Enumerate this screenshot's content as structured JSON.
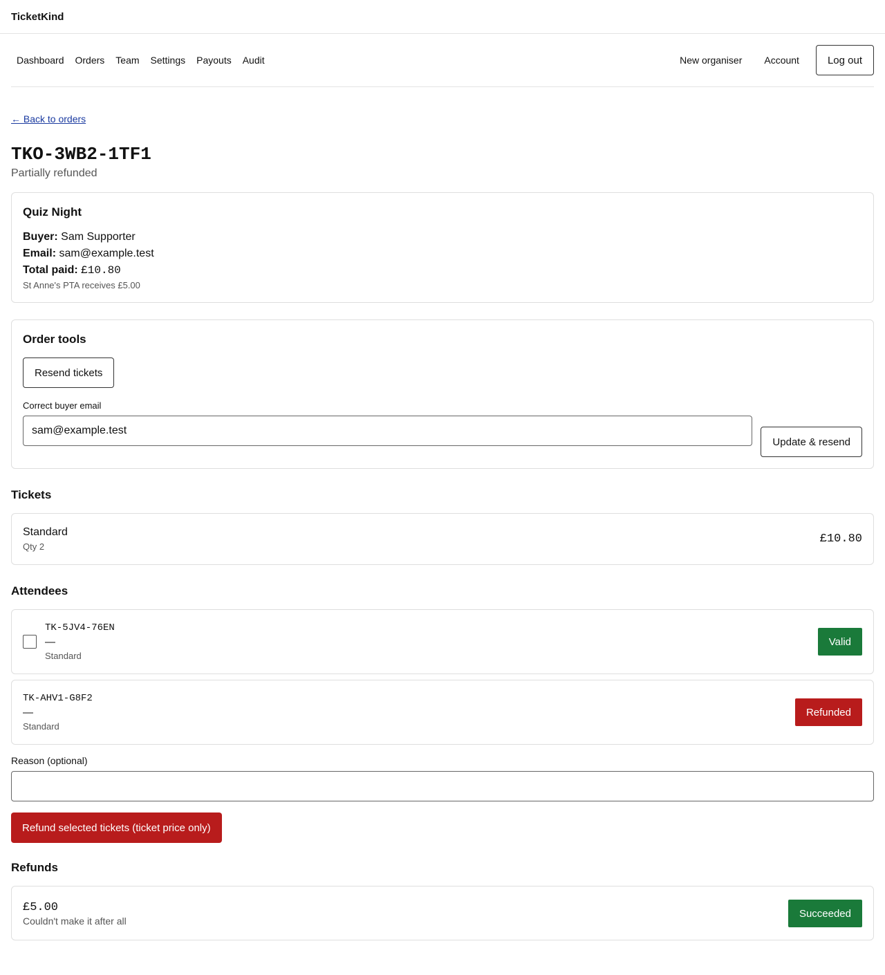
{
  "app": {
    "brand": "TicketKind"
  },
  "nav": {
    "left": [
      "Dashboard",
      "Orders",
      "Team",
      "Settings",
      "Payouts",
      "Audit"
    ],
    "right": [
      "New organiser",
      "Account"
    ],
    "logout": "Log out"
  },
  "back_link": "← Back to orders",
  "order": {
    "reference": "TKO-3WB2-1TF1",
    "status": "Partially refunded"
  },
  "summary": {
    "event": "Quiz Night",
    "buyer_label": "Buyer:",
    "buyer": "Sam Supporter",
    "email_label": "Email:",
    "email": "sam@example.test",
    "total_label": "Total paid:",
    "total": "£10.80",
    "beneficiary_note": "St Anne's PTA receives £5.00"
  },
  "tools": {
    "title": "Order tools",
    "resend_label": "Resend tickets",
    "email_field_label": "Correct buyer email",
    "email_value": "sam@example.test",
    "update_label": "Update & resend"
  },
  "tickets": {
    "heading": "Tickets",
    "items": [
      {
        "name": "Standard",
        "qty": "Qty 2",
        "price": "£10.80"
      }
    ]
  },
  "attendees": {
    "heading": "Attendees",
    "items": [
      {
        "code": "TK-5JV4-76EN",
        "name": "—",
        "type": "Standard",
        "status": "Valid",
        "selectable": true
      },
      {
        "code": "TK-AHV1-G8F2",
        "name": "—",
        "type": "Standard",
        "status": "Refunded",
        "selectable": false
      }
    ]
  },
  "refund_form": {
    "reason_label": "Reason (optional)",
    "reason_value": "",
    "submit_label": "Refund selected tickets (ticket price only)"
  },
  "refunds": {
    "heading": "Refunds",
    "items": [
      {
        "amount": "£5.00",
        "reason": "Couldn't make it after all",
        "status": "Succeeded"
      }
    ]
  },
  "colors": {
    "success": "#1a7a3a",
    "danger": "#b81c1c",
    "link": "#1a3aa0"
  }
}
